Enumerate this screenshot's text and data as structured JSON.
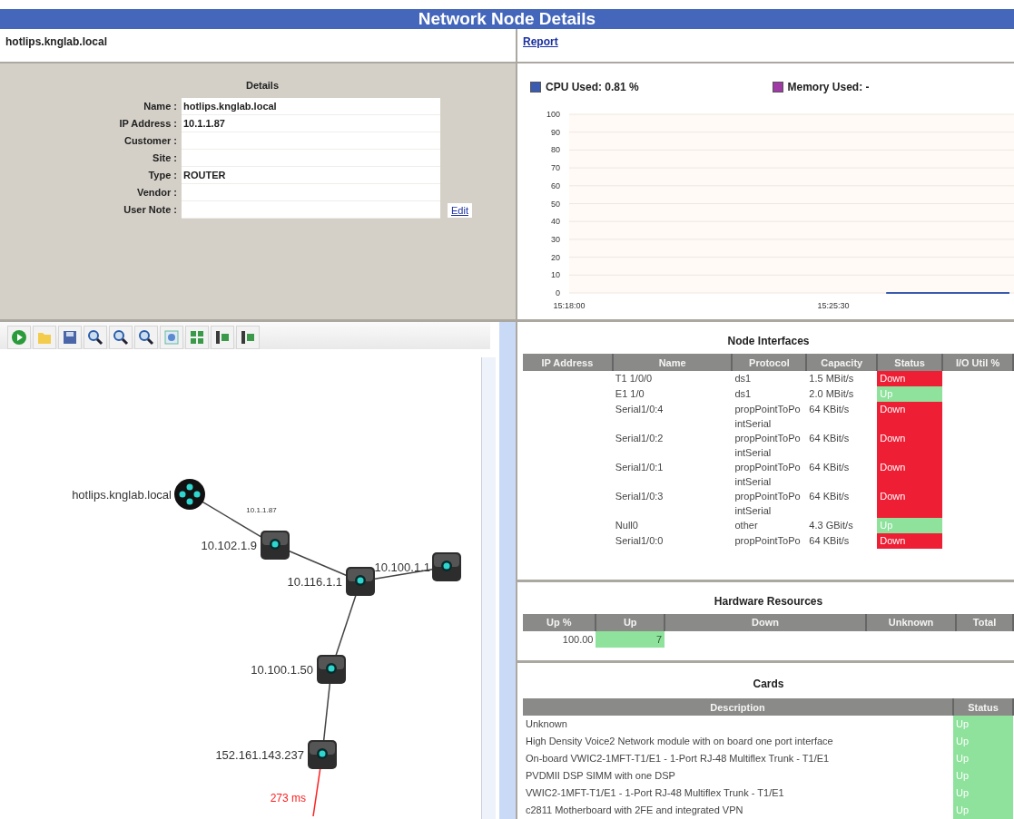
{
  "title": "Network Node Details",
  "node_header": {
    "name": "hotlips.knglab.local",
    "report_link": "Report"
  },
  "details": {
    "heading": "Details",
    "edit_link": "Edit",
    "fields": [
      {
        "label": "Name :",
        "value": "hotlips.knglab.local"
      },
      {
        "label": "IP Address :",
        "value": "10.1.1.87"
      },
      {
        "label": "Customer :"
      },
      {
        "label": "Site :"
      },
      {
        "label": "Type :",
        "value": "ROUTER"
      },
      {
        "label": "Vendor :"
      },
      {
        "label": "User Note :"
      }
    ]
  },
  "performance": {
    "legend": [
      {
        "label": "CPU Used: 0.81 %",
        "color": "#3a5bb0"
      },
      {
        "label": "Memory Used: -",
        "color": "#a03aa6"
      }
    ],
    "chart_data": {
      "type": "line",
      "categories": [
        "15:18:00",
        null,
        null,
        null,
        null,
        null,
        null,
        null,
        null,
        null,
        null,
        null,
        null,
        null,
        null,
        "15:25:30",
        null,
        null,
        null,
        null,
        null,
        null,
        null,
        null,
        null,
        null
      ],
      "grid": true,
      "ylim": [
        0,
        100
      ],
      "yticks": [
        0,
        10,
        20,
        30,
        40,
        50,
        60,
        70,
        80,
        90,
        100
      ],
      "series": [
        {
          "color": "#3a5bb0",
          "values": [
            null,
            null,
            null,
            null,
            null,
            null,
            null,
            null,
            null,
            null,
            null,
            null,
            null,
            null,
            null,
            null,
            null,
            null,
            0,
            0,
            0,
            0,
            0,
            0,
            0,
            0
          ]
        }
      ]
    }
  },
  "topology": {
    "nodes": [
      {
        "label": "hotlips.knglab.local",
        "kind": "cloud",
        "children": [
          {
            "label": "10.102.1.9",
            "kind": "router",
            "link_label": "10.1.1.87",
            "children": [
              {
                "label": "10.116.1.1",
                "kind": "router",
                "children": [
                  {
                    "label": "10.100.1.1",
                    "kind": "router"
                  },
                  {
                    "label": "10.100.1.50",
                    "kind": "router",
                    "children": [
                      {
                        "label": "152.161.143.237",
                        "kind": "router",
                        "latency": "273 ms"
                      }
                    ]
                  }
                ]
              }
            ]
          }
        ]
      }
    ]
  },
  "interfaces": {
    "title": "Node Interfaces",
    "columns": [
      "IP Address",
      "Name",
      "Protocol",
      "Capacity",
      "Status",
      "I/O Util %"
    ],
    "rows": [
      {
        "name": "T1 1/0/0",
        "protocol": "ds1",
        "capacity": "1.5 MBit/s",
        "status": "Down",
        "color": "#ee1f35"
      },
      {
        "name": "E1 1/0",
        "protocol": "ds1",
        "capacity": "2.0 MBit/s",
        "status": "Up",
        "color": "#8ee29c"
      },
      {
        "name": "Serial1/0:4",
        "protocol": "propPointToPointSerial",
        "capacity": "64 KBit/s",
        "status": "Down",
        "color": "#ee1f35"
      },
      {
        "name": "Serial1/0:2",
        "protocol": "propPointToPointSerial",
        "capacity": "64 KBit/s",
        "status": "Down",
        "color": "#ee1f35"
      },
      {
        "name": "Serial1/0:1",
        "protocol": "propPointToPointSerial",
        "capacity": "64 KBit/s",
        "status": "Down",
        "color": "#ee1f35"
      },
      {
        "name": "Serial1/0:3",
        "protocol": "propPointToPointSerial",
        "capacity": "64 KBit/s",
        "status": "Down",
        "color": "#ee1f35"
      },
      {
        "name": "Null0",
        "protocol": "other",
        "capacity": "4.3 GBit/s",
        "status": "Up",
        "color": "#8ee29c"
      },
      {
        "name": "Serial1/0:0",
        "protocol": "propPointToPo",
        "capacity": "64 KBit/s",
        "status": "Down",
        "color": "#ee1f35"
      }
    ]
  },
  "hardware": {
    "title": "Hardware Resources",
    "columns": [
      "Up %",
      "Up",
      "Down",
      "Unknown",
      "Total"
    ],
    "rows": [
      {
        "up_percent": "100.00",
        "up": "7"
      }
    ]
  },
  "cards": {
    "title": "Cards",
    "columns": [
      "Description",
      "Status"
    ],
    "rows": [
      {
        "description": "Unknown",
        "status": "Up",
        "color": "#8ee29c"
      },
      {
        "description": "High Density Voice2 Network module with on board one port interface",
        "status": "Up",
        "color": "#8ee29c"
      },
      {
        "description": "On-board VWIC2-1MFT-T1/E1 - 1-Port RJ-48 Multiflex Trunk - T1/E1",
        "status": "Up",
        "color": "#8ee29c"
      },
      {
        "description": "PVDMII DSP SIMM with one DSP",
        "status": "Up",
        "color": "#8ee29c"
      },
      {
        "description": "VWIC2-1MFT-T1/E1 - 1-Port RJ-48 Multiflex Trunk - T1/E1",
        "status": "Up",
        "color": "#8ee29c"
      },
      {
        "description": "c2811 Motherboard with 2FE and integrated VPN",
        "status": "Up",
        "color": "#8ee29c"
      }
    ]
  }
}
